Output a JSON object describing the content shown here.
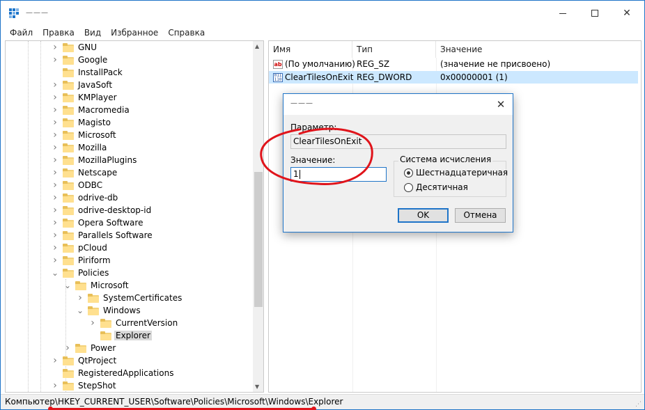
{
  "window": {
    "title": "———",
    "minimize_label": "",
    "maximize_label": "",
    "close_label": "✕"
  },
  "menu": [
    "Файл",
    "Правка",
    "Вид",
    "Избранное",
    "Справка"
  ],
  "tree": {
    "items": [
      {
        "label": "GNU",
        "level": 0,
        "expander": "right"
      },
      {
        "label": "Google",
        "level": 0,
        "expander": "right"
      },
      {
        "label": "InstallPack",
        "level": 0,
        "expander": "none"
      },
      {
        "label": "JavaSoft",
        "level": 0,
        "expander": "right"
      },
      {
        "label": "KMPlayer",
        "level": 0,
        "expander": "right"
      },
      {
        "label": "Macromedia",
        "level": 0,
        "expander": "right"
      },
      {
        "label": "Magisto",
        "level": 0,
        "expander": "right"
      },
      {
        "label": "Microsoft",
        "level": 0,
        "expander": "right"
      },
      {
        "label": "Mozilla",
        "level": 0,
        "expander": "right"
      },
      {
        "label": "MozillaPlugins",
        "level": 0,
        "expander": "right"
      },
      {
        "label": "Netscape",
        "level": 0,
        "expander": "right"
      },
      {
        "label": "ODBC",
        "level": 0,
        "expander": "right"
      },
      {
        "label": "odrive-db",
        "level": 0,
        "expander": "right"
      },
      {
        "label": "odrive-desktop-id",
        "level": 0,
        "expander": "right"
      },
      {
        "label": "Opera Software",
        "level": 0,
        "expander": "right"
      },
      {
        "label": "Parallels Software",
        "level": 0,
        "expander": "right"
      },
      {
        "label": "pCloud",
        "level": 0,
        "expander": "right"
      },
      {
        "label": "Piriform",
        "level": 0,
        "expander": "right"
      },
      {
        "label": "Policies",
        "level": 0,
        "expander": "down"
      },
      {
        "label": "Microsoft",
        "level": 1,
        "expander": "down"
      },
      {
        "label": "SystemCertificates",
        "level": 2,
        "expander": "right"
      },
      {
        "label": "Windows",
        "level": 2,
        "expander": "down"
      },
      {
        "label": "CurrentVersion",
        "level": 3,
        "expander": "right"
      },
      {
        "label": "Explorer",
        "level": 3,
        "expander": "none",
        "selected": true
      },
      {
        "label": "Power",
        "level": 1,
        "expander": "right"
      },
      {
        "label": "QtProject",
        "level": 0,
        "expander": "right"
      },
      {
        "label": "RegisteredApplications",
        "level": 0,
        "expander": "none"
      },
      {
        "label": "StepShot",
        "level": 0,
        "expander": "right"
      }
    ]
  },
  "values": {
    "columns": {
      "name": "Имя",
      "type": "Тип",
      "data": "Значение"
    },
    "rows": [
      {
        "icon": "string-value-icon",
        "name": "(По умолчанию)",
        "type": "REG_SZ",
        "data": "(значение не присвоено)",
        "selected": false
      },
      {
        "icon": "binary-value-icon",
        "name": "ClearTilesOnExit",
        "type": "REG_DWORD",
        "data": "0x00000001 (1)",
        "selected": true
      }
    ]
  },
  "dialog": {
    "title": "———",
    "param_label": "Параметр:",
    "param_value": "ClearTilesOnExit",
    "value_label": "Значение:",
    "value_value": "1",
    "base_legend": "Система исчисления",
    "radio_hex": "Шестнадцатеричная",
    "radio_dec": "Десятичная",
    "ok": "OK",
    "cancel": "Отмена",
    "close": "✕"
  },
  "status": {
    "path": "Компьютер\\HKEY_CURRENT_USER\\Software\\Policies\\Microsoft\\Windows\\Explorer"
  },
  "colors": {
    "accent": "#1e74c8",
    "annotation": "#e0141b",
    "selection": "#cce8ff"
  }
}
